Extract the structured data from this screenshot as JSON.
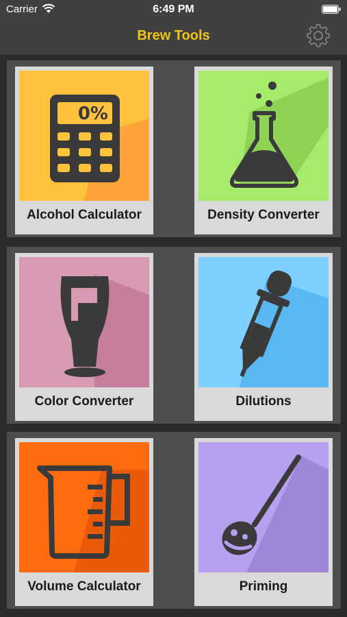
{
  "status_bar": {
    "carrier": "Carrier",
    "time": "6:49 PM"
  },
  "nav": {
    "title": "Brew Tools",
    "settings_icon": "gear-icon"
  },
  "tools": [
    {
      "label": "Alcohol Calculator",
      "icon": "calculator-icon",
      "color": "#ffb83b"
    },
    {
      "label": "Density Converter",
      "icon": "flask-icon",
      "color": "#a6e66a"
    },
    {
      "label": "Color Converter",
      "icon": "beer-glass-icon",
      "color": "#cc8aa4"
    },
    {
      "label": "Dilutions",
      "icon": "dropper-icon",
      "color": "#5cb8f0"
    },
    {
      "label": "Volume Calculator",
      "icon": "measuring-cup-icon",
      "color": "#ff6a14"
    },
    {
      "label": "Priming",
      "icon": "spoon-icon",
      "color": "#b09ae0"
    }
  ],
  "calculator_display": "0%"
}
